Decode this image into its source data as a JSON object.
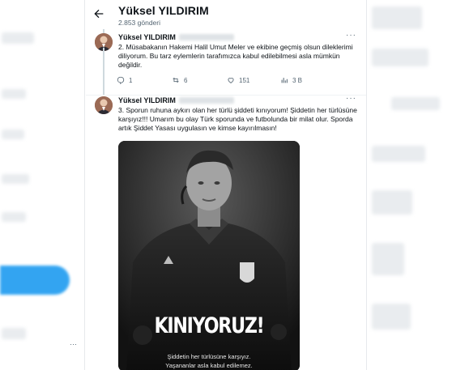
{
  "header": {
    "title": "Yüksel YILDIRIM",
    "post_count": "2.853 gönderi"
  },
  "tweets": [
    {
      "name": "Yüksel YILDIRIM",
      "text": "2. Müsabakanın Hakemi Halil Umut Meler ve ekibine geçmiş olsun dileklerimi diliyorum. Bu tarz eylemlerin tarafımızca kabul edilebilmesi asla mümkün değildir.",
      "replies": "1",
      "reposts": "6",
      "likes": "151",
      "views": "3 B"
    },
    {
      "name": "Yüksel YILDIRIM",
      "text": "3. Sporun ruhuna aykırı olan her türlü şiddeti kınıyorum! Şiddetin her türlüsüne karşıyız!!! Umarım bu olay Türk sporunda ve futbolunda bir milat olur. Sporda artık Şiddet Yasası uygulasın ve kimse kayırılmasın!",
      "media": {
        "headline": "KINIYORUZ!",
        "caption_line1": "Şiddetin her türlüsüne karşıyız.",
        "caption_line2": "Yaşananlar asla kabul edilemez."
      }
    }
  ],
  "icons": {
    "back": "arrow-left-icon",
    "more": "more-horizontal-icon",
    "reply": "reply-icon",
    "repost": "repost-icon",
    "like": "heart-icon",
    "views": "views-icon"
  },
  "colors": {
    "accent": "#1d9bf0",
    "text_primary": "#0f1419",
    "text_secondary": "#536471"
  }
}
